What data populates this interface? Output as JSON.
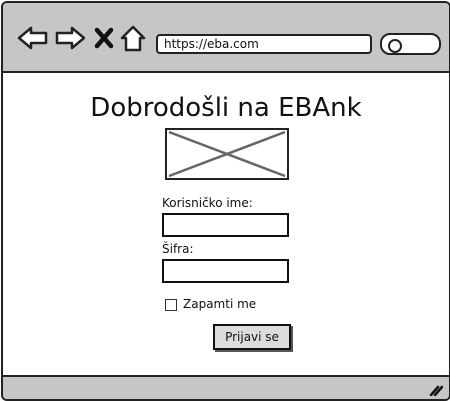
{
  "browser": {
    "url": "https://eba.com",
    "back_icon": "back-arrow-icon",
    "forward_icon": "forward-arrow-icon",
    "close_icon": "close-x-icon",
    "home_icon": "home-icon",
    "search_icon": "search-icon"
  },
  "page": {
    "title": "Dobrodošli na EBAnk",
    "username_label": "Korisničko ime:",
    "username_value": "",
    "password_label": "Šifra:",
    "password_value": "",
    "remember_label": "Zapamti me",
    "login_button": "Prijavi se"
  }
}
